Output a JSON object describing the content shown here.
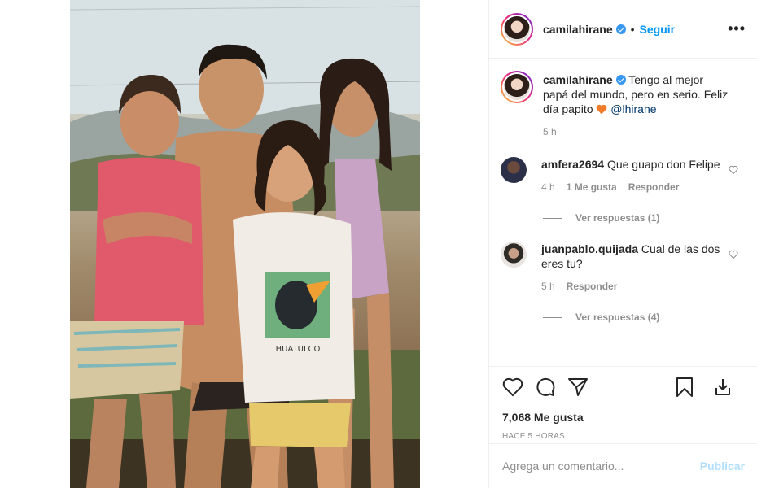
{
  "post": {
    "author": "camilahirane",
    "follow_label": "Seguir",
    "dot": "•",
    "more_label": "•••"
  },
  "caption": {
    "user": "camilahirane",
    "text": "Tengo al mejor papá del mundo, pero en serio. Feliz día papito",
    "mention": "@lhirane",
    "time": "5 h"
  },
  "comments": [
    {
      "user": "amfera2694",
      "text": "Que guapo don Felipe",
      "time": "4 h",
      "likes": "1 Me gusta",
      "reply": "Responder",
      "view_replies": "Ver respuestas (1)"
    },
    {
      "user": "juanpablo.quijada",
      "text": "Cual de las dos eres tu?",
      "time": "5 h",
      "reply": "Responder",
      "view_replies": "Ver respuestas (4)"
    }
  ],
  "stats": {
    "likes": "7,068 Me gusta",
    "posted": "HACE 5 HORAS"
  },
  "composer": {
    "placeholder": "Agrega un comentario...",
    "post_label": "Publicar"
  },
  "photo": {
    "shirt_print": "HUATULCO"
  },
  "icons": {
    "like": "heart-icon",
    "comment": "comment-icon",
    "share": "share-icon",
    "save": "bookmark-icon",
    "download": "download-icon",
    "verified": "verified-badge-icon"
  },
  "colors": {
    "link": "#0095f6",
    "verified": "#3897f0",
    "muted": "#8e8e8e",
    "emoji_heart": "#f07b2a"
  }
}
